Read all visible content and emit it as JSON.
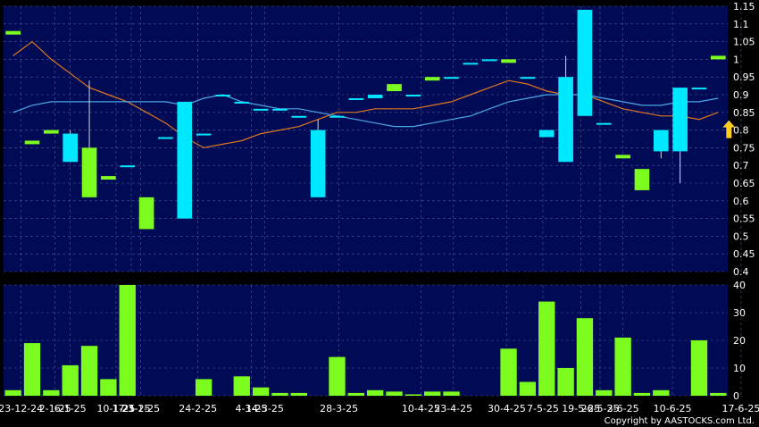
{
  "chart_data": [
    {
      "type": "candlestick",
      "panel": "price",
      "x": [
        "23-12-24",
        "2-1-25",
        "6-1-25",
        "10-1-25",
        "13-1-25",
        "15-1-25",
        "17-1-25",
        "21-1-25",
        "23-1-25",
        "3-2-25",
        "24-2-25",
        "3-3-25",
        "4-3-25",
        "5-3-25",
        "13-3-25",
        "17-3-25",
        "28-3-25",
        "31-3-25",
        "3-4-25",
        "7-4-25",
        "10-4-25",
        "16-4-25",
        "23-4-25",
        "25-4-25",
        "30-4-25",
        "2-5-25",
        "7-5-25",
        "15-5-25",
        "19-5-25",
        "26-5-25",
        "29-5-25",
        "30-5-25",
        "3-6-25",
        "5-6-25",
        "10-6-25",
        "12-6-25",
        "16-6-25",
        "17-6-25"
      ],
      "open": [
        1.08,
        0.77,
        0.8,
        0.71,
        0.75,
        0.67,
        0.7,
        0.61,
        0.78,
        0.55,
        0.79,
        0.9,
        0.88,
        0.86,
        0.86,
        0.84,
        0.61,
        0.84,
        0.89,
        0.89,
        0.93,
        0.9,
        0.95,
        0.95,
        0.99,
        1.0,
        1.0,
        0.95,
        0.78,
        0.71,
        0.84,
        0.82,
        0.73,
        0.69,
        0.74,
        0.74,
        0.92,
        1.01
      ],
      "close": [
        1.07,
        0.76,
        0.79,
        0.79,
        0.61,
        0.66,
        0.7,
        0.52,
        0.78,
        0.88,
        0.79,
        0.9,
        0.88,
        0.86,
        0.86,
        0.84,
        0.8,
        0.84,
        0.89,
        0.9,
        0.91,
        0.9,
        0.94,
        0.95,
        0.99,
        1.0,
        0.99,
        0.95,
        0.8,
        0.95,
        1.14,
        0.82,
        0.72,
        0.63,
        0.8,
        0.92,
        0.92,
        1.0
      ],
      "high": [
        1.08,
        0.77,
        0.8,
        0.8,
        0.94,
        0.67,
        0.7,
        0.61,
        0.78,
        0.88,
        0.79,
        0.9,
        0.88,
        0.86,
        0.86,
        0.84,
        0.83,
        0.84,
        0.89,
        0.9,
        0.93,
        0.9,
        0.95,
        0.95,
        0.99,
        1.0,
        1.0,
        0.95,
        0.8,
        1.01,
        1.14,
        0.82,
        0.73,
        0.69,
        0.8,
        0.92,
        0.92,
        1.01
      ],
      "low": [
        1.07,
        0.76,
        0.79,
        0.71,
        0.61,
        0.66,
        0.7,
        0.52,
        0.78,
        0.55,
        0.79,
        0.9,
        0.88,
        0.86,
        0.86,
        0.84,
        0.61,
        0.84,
        0.89,
        0.89,
        0.91,
        0.9,
        0.94,
        0.95,
        0.99,
        1.0,
        0.99,
        0.95,
        0.78,
        0.71,
        0.84,
        0.82,
        0.72,
        0.63,
        0.72,
        0.65,
        0.92,
        1.0
      ],
      "moving_averages": [
        {
          "color": "#e07820",
          "values": [
            1.01,
            1.05,
            1.0,
            0.96,
            0.92,
            0.9,
            0.88,
            0.85,
            0.82,
            0.78,
            0.75,
            0.76,
            0.77,
            0.79,
            0.8,
            0.81,
            0.83,
            0.85,
            0.85,
            0.86,
            0.86,
            0.86,
            0.87,
            0.88,
            0.9,
            0.92,
            0.94,
            0.93,
            0.91,
            0.9,
            0.9,
            0.88,
            0.86,
            0.85,
            0.84,
            0.84,
            0.83,
            0.85
          ]
        },
        {
          "color": "#4aa8e8",
          "values": [
            0.85,
            0.87,
            0.88,
            0.88,
            0.88,
            0.88,
            0.88,
            0.88,
            0.88,
            0.87,
            0.89,
            0.9,
            0.88,
            0.87,
            0.86,
            0.86,
            0.85,
            0.84,
            0.83,
            0.82,
            0.81,
            0.81,
            0.82,
            0.83,
            0.84,
            0.86,
            0.88,
            0.89,
            0.9,
            0.9,
            0.9,
            0.89,
            0.88,
            0.87,
            0.87,
            0.88,
            0.88,
            0.89
          ]
        }
      ],
      "ylim": [
        0.4,
        1.15
      ],
      "yticks": [
        0.4,
        0.45,
        0.5,
        0.55,
        0.6,
        0.65,
        0.7,
        0.75,
        0.8,
        0.85,
        0.9,
        0.95,
        1,
        1.05,
        1.1,
        1.15
      ],
      "ytick_labels": [
        "0.4",
        "0.45",
        "0.5",
        "0.55",
        "0.6",
        "0.65",
        "0.7",
        "0.75",
        "0.8",
        "0.85",
        "0.9",
        "0.95",
        "1",
        "1.05",
        "1.1",
        "1.15"
      ],
      "up_color": "#00e8ff",
      "down_color": "#7cfc1e",
      "grid": true,
      "background": "#000a55"
    },
    {
      "type": "bar",
      "panel": "volume",
      "values": [
        2,
        19,
        2,
        11,
        18,
        6,
        40,
        0,
        0,
        0,
        6,
        0,
        7,
        3,
        1,
        1,
        0,
        14,
        1,
        2,
        1.5,
        0.5,
        1.5,
        1.5,
        0,
        0,
        17,
        5,
        34,
        10,
        28,
        2,
        21,
        1,
        2,
        0,
        20,
        1
      ],
      "ylim": [
        0,
        40
      ],
      "yticks": [
        0,
        10,
        20,
        30,
        40
      ],
      "ytick_labels": [
        "0",
        "10",
        "20",
        "30",
        "40"
      ],
      "color": "#7cfc1e",
      "grid": true,
      "background": "#000a55"
    }
  ],
  "x_tick_labels": [
    {
      "i": 0.4,
      "label": "23-12-24"
    },
    {
      "i": 2.2,
      "label": "2-1-25"
    },
    {
      "i": 3.0,
      "label": "6-1-25"
    },
    {
      "i": 5.4,
      "label": "10-1-25"
    },
    {
      "i": 6.2,
      "label": "17-1-25"
    },
    {
      "i": 6.7,
      "label": "23-1-25"
    },
    {
      "i": 9.7,
      "label": "24-2-25"
    },
    {
      "i": 12.5,
      "label": "4-3-25"
    },
    {
      "i": 13.2,
      "label": "14-3-25"
    },
    {
      "i": 17.1,
      "label": "28-3-25"
    },
    {
      "i": 21.4,
      "label": "10-4-25"
    },
    {
      "i": 23.1,
      "label": "23-4-25"
    },
    {
      "i": 25.9,
      "label": "30-4-25"
    },
    {
      "i": 27.8,
      "label": "7-5-25"
    },
    {
      "i": 29.8,
      "label": "19-5-25"
    },
    {
      "i": 30.8,
      "label": "26-5-25"
    },
    {
      "i": 32.0,
      "label": "3-6-25"
    },
    {
      "i": 34.6,
      "label": "10-6-25"
    },
    {
      "i": 38.2,
      "label": "17-6-25"
    }
  ],
  "copyright": "Copyright by AASTOCKS.com Ltd.",
  "indicator": {
    "icon": "up-arrow-icon",
    "color": "#ffcc22",
    "value": 0.8
  }
}
